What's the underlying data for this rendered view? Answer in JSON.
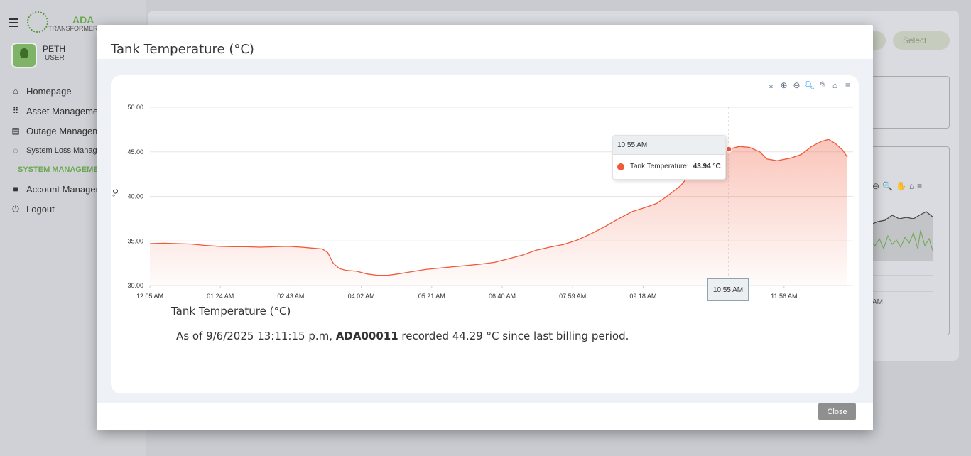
{
  "app": {
    "logo_title": "ADA",
    "logo_subtitle": "TRANSFORMER S",
    "user_name": "PETH",
    "user_role": "USER"
  },
  "sidebar": {
    "items": [
      {
        "label": "Homepage",
        "icon": "home-icon"
      },
      {
        "label": "Asset Managemen",
        "icon": "grid-icon"
      },
      {
        "label": "Outage Managem",
        "icon": "clipboard-icon"
      },
      {
        "label": "System Loss Manag",
        "icon": "spinner-icon"
      },
      {
        "label": "SYSTEM MANAGEMEN",
        "icon": ""
      },
      {
        "label": "Account Managem",
        "icon": "lock-icon"
      },
      {
        "label": "Logout",
        "icon": "power-icon"
      }
    ]
  },
  "background": {
    "select_label": "Select",
    "x_fragment": "AM"
  },
  "modal": {
    "title": "Tank Temperature (°C)",
    "close_label": "Close",
    "caption": "Tank Temperature (°C)",
    "summary_prefix": "As of 9/6/2025 13:11:15 p.m, ",
    "summary_asset": "ADA00011",
    "summary_suffix": " recorded 44.29 °C since last billing period.",
    "toolbar": [
      "download-icon",
      "zoom-in-icon",
      "zoom-out-icon",
      "selection-zoom-icon",
      "pan-icon",
      "reset-home-icon",
      "menu-icon"
    ]
  },
  "tooltip": {
    "time": "10:55 AM",
    "series": "Tank Temperature:",
    "value": "43.94 °C",
    "x_label": "10:55 AM"
  },
  "chart_data": {
    "type": "area",
    "title": "",
    "xlabel": "",
    "ylabel": "°C",
    "ylim": [
      30,
      50
    ],
    "y_ticks": [
      "30.00",
      "35.00",
      "40.00",
      "45.00",
      "50.00"
    ],
    "x_ticks": [
      "12:05 AM",
      "01:24 AM",
      "02:43 AM",
      "04:02 AM",
      "05:21 AM",
      "06:40 AM",
      "07:59 AM",
      "09:18 AM",
      "10:",
      "11:56 AM"
    ],
    "color": "#f0593a",
    "series": [
      {
        "name": "Tank Temperature",
        "points": [
          [
            0,
            34.7
          ],
          [
            20,
            34.75
          ],
          [
            40,
            34.7
          ],
          [
            60,
            34.65
          ],
          [
            80,
            34.5
          ],
          [
            100,
            34.4
          ],
          [
            120,
            34.35
          ],
          [
            140,
            34.35
          ],
          [
            160,
            34.3
          ],
          [
            180,
            34.35
          ],
          [
            200,
            34.4
          ],
          [
            220,
            34.3
          ],
          [
            235,
            34.2
          ],
          [
            250,
            34.1
          ],
          [
            258,
            33.7
          ],
          [
            266,
            32.5
          ],
          [
            275,
            31.9
          ],
          [
            285,
            31.7
          ],
          [
            300,
            31.6
          ],
          [
            315,
            31.3
          ],
          [
            330,
            31.15
          ],
          [
            345,
            31.15
          ],
          [
            360,
            31.3
          ],
          [
            380,
            31.55
          ],
          [
            400,
            31.8
          ],
          [
            420,
            31.95
          ],
          [
            440,
            32.1
          ],
          [
            460,
            32.25
          ],
          [
            480,
            32.4
          ],
          [
            500,
            32.6
          ],
          [
            520,
            33.0
          ],
          [
            540,
            33.4
          ],
          [
            560,
            33.95
          ],
          [
            580,
            34.3
          ],
          [
            600,
            34.6
          ],
          [
            620,
            35.1
          ],
          [
            640,
            35.8
          ],
          [
            660,
            36.6
          ],
          [
            680,
            37.5
          ],
          [
            700,
            38.3
          ],
          [
            720,
            38.8
          ],
          [
            735,
            39.2
          ],
          [
            750,
            40.0
          ],
          [
            770,
            41.2
          ],
          [
            785,
            42.6
          ],
          [
            800,
            43.5
          ],
          [
            815,
            43.94
          ],
          [
            825,
            44.6
          ],
          [
            840,
            45.3
          ],
          [
            855,
            45.6
          ],
          [
            870,
            45.5
          ],
          [
            885,
            45.0
          ],
          [
            895,
            44.2
          ],
          [
            910,
            44.0
          ],
          [
            930,
            44.3
          ],
          [
            945,
            44.7
          ],
          [
            960,
            45.6
          ],
          [
            975,
            46.2
          ],
          [
            985,
            46.4
          ],
          [
            995,
            45.9
          ],
          [
            1005,
            45.2
          ],
          [
            1012,
            44.4
          ]
        ]
      }
    ],
    "highlight_index": 48
  }
}
